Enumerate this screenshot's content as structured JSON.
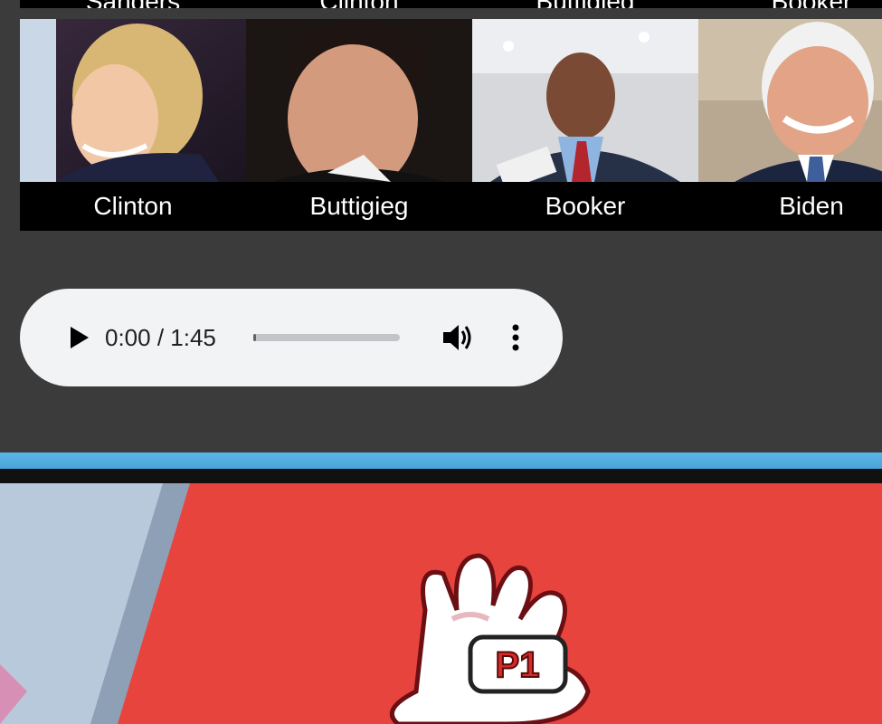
{
  "candidates_top_cut": [
    "Sanders",
    "Clinton",
    "Buttigieg",
    "Booker"
  ],
  "candidates": [
    {
      "name": "Clinton"
    },
    {
      "name": "Buttigieg"
    },
    {
      "name": "Booker"
    },
    {
      "name": "Biden"
    }
  ],
  "audio": {
    "time": "0:00 / 1:45",
    "progress": 0.0
  },
  "banner": {
    "badge": "P1",
    "colors": {
      "background": "#e8443e",
      "stripe": "#5bb6e6"
    }
  }
}
